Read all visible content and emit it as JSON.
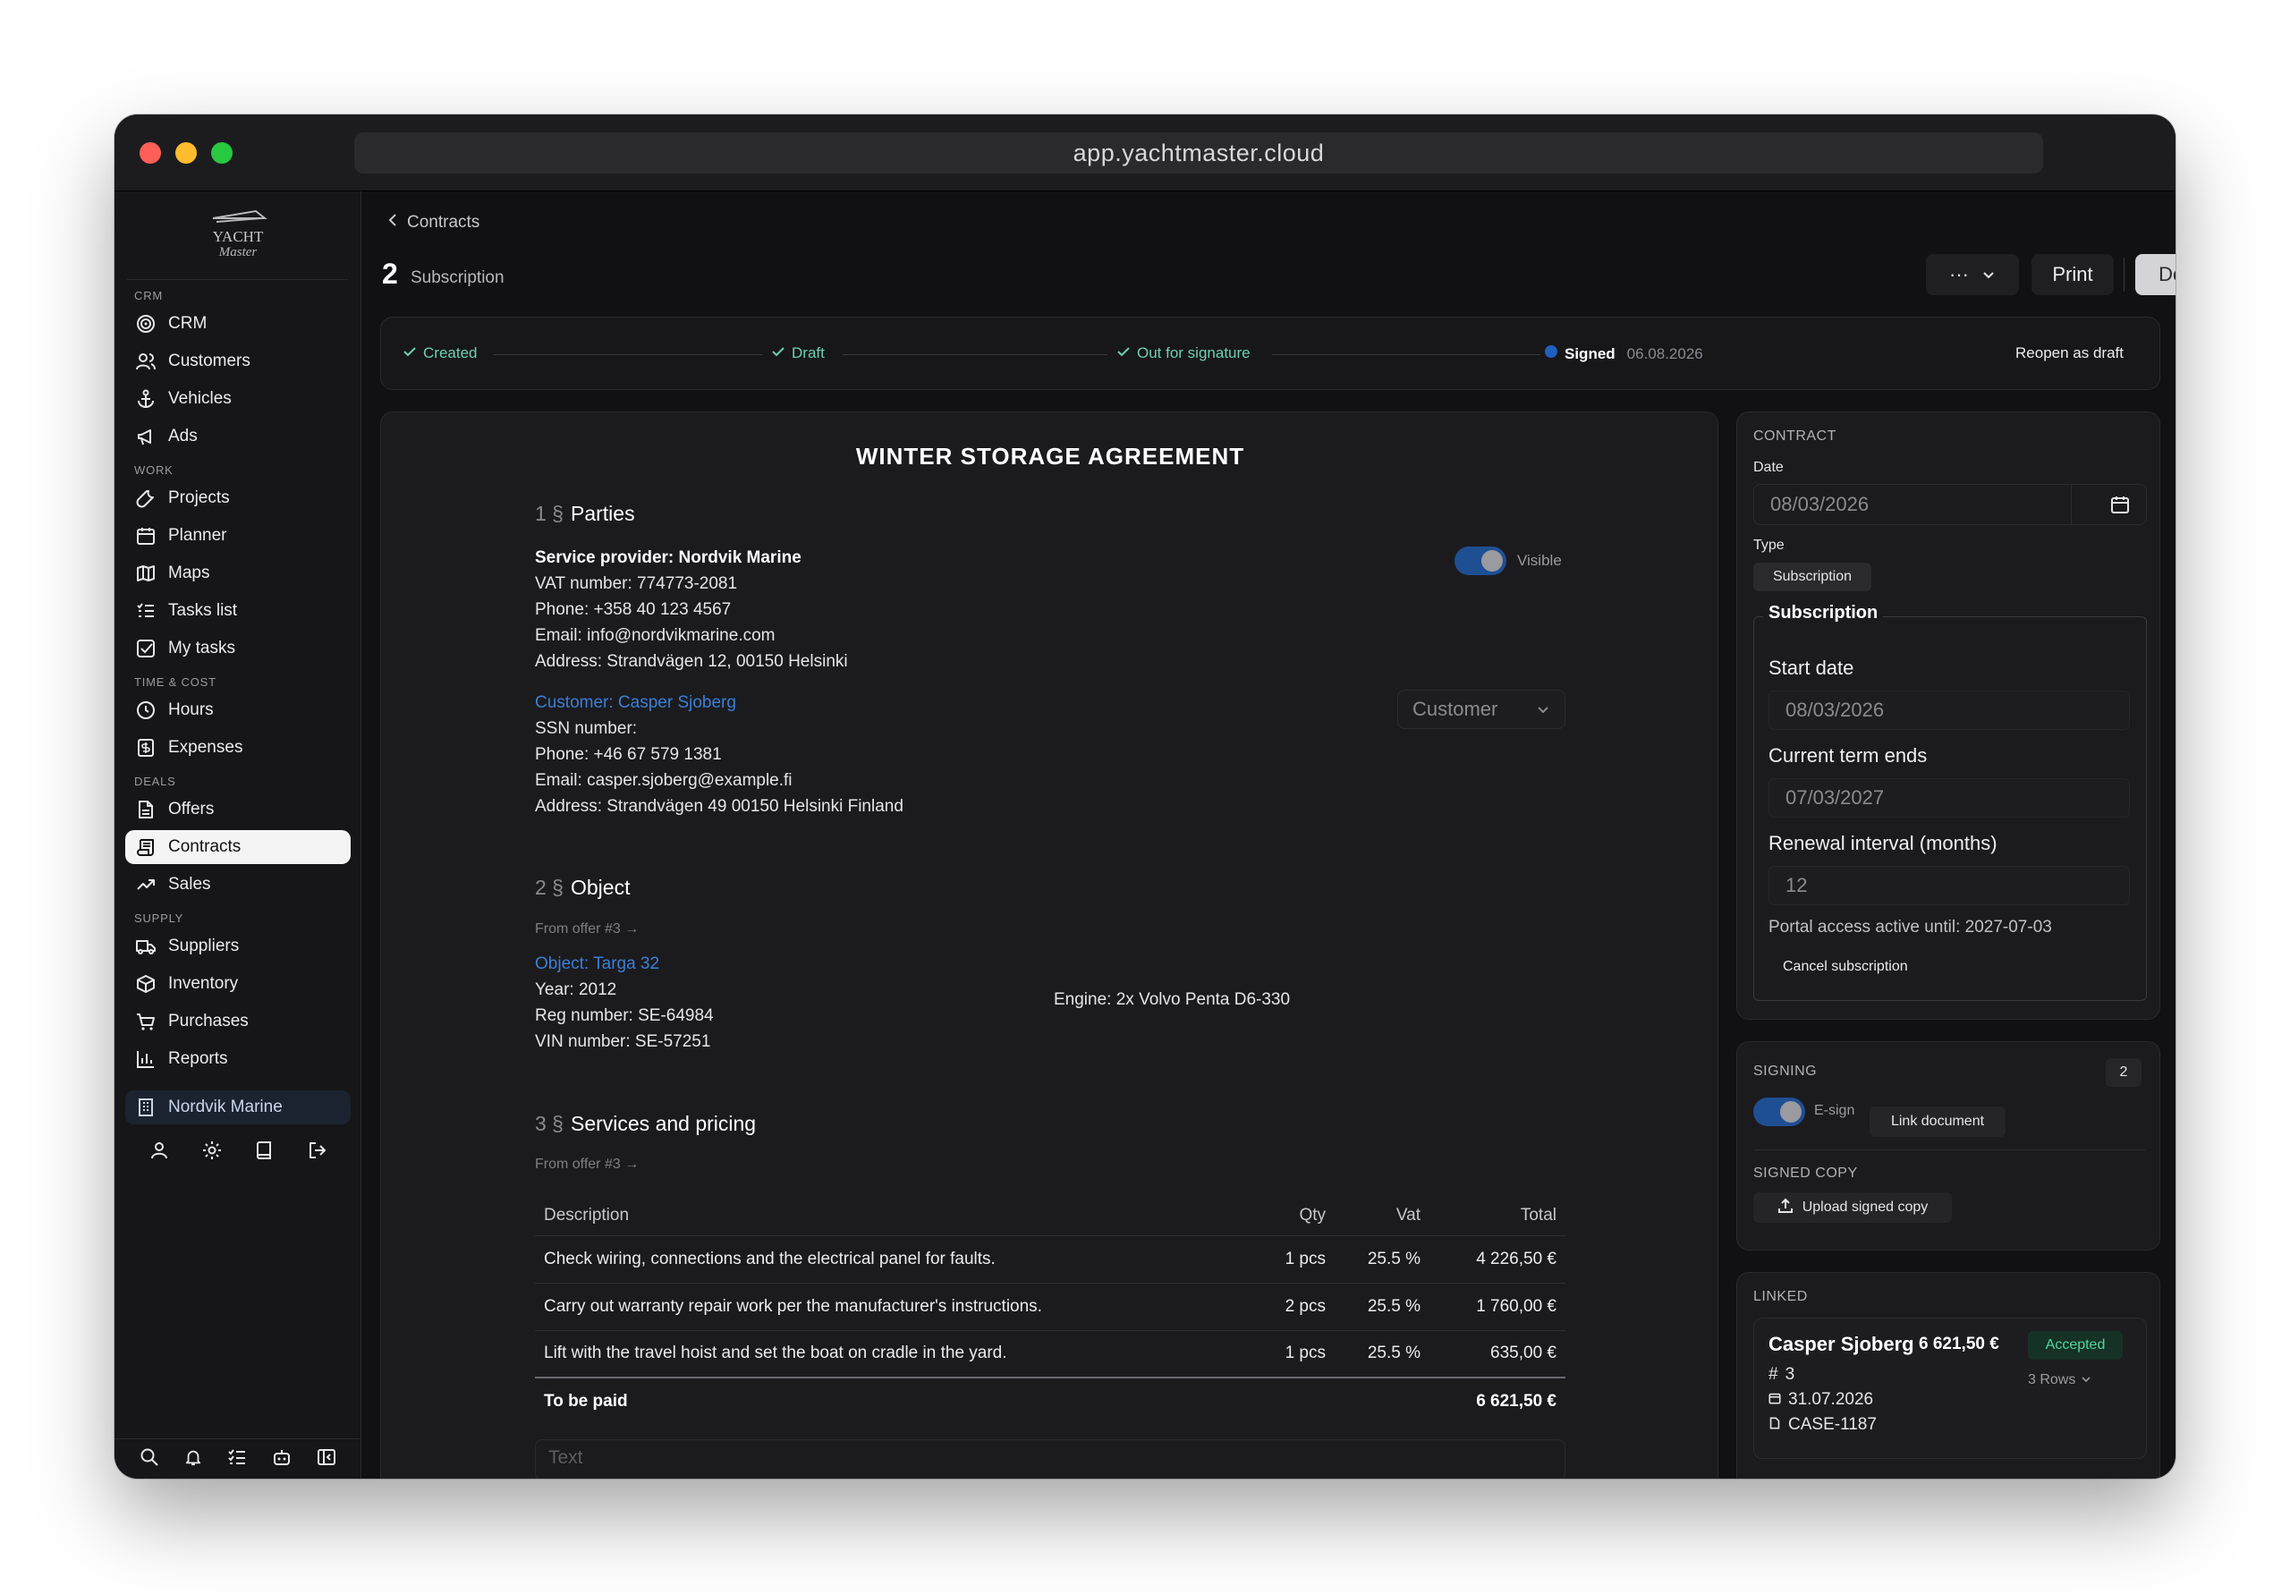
{
  "browser": {
    "url": "app.yachtmaster.cloud"
  },
  "logo": {
    "line1": "YACHT",
    "line2": "Master"
  },
  "sidebar": {
    "sections": [
      {
        "label": "CRM",
        "items": [
          {
            "label": "CRM",
            "icon": "target-icon"
          },
          {
            "label": "Customers",
            "icon": "users-icon"
          },
          {
            "label": "Vehicles",
            "icon": "anchor-icon"
          },
          {
            "label": "Ads",
            "icon": "megaphone-icon"
          }
        ]
      },
      {
        "label": "WORK",
        "items": [
          {
            "label": "Projects",
            "icon": "wrench-icon"
          },
          {
            "label": "Planner",
            "icon": "calendar-icon"
          },
          {
            "label": "Maps",
            "icon": "map-icon"
          },
          {
            "label": "Tasks list",
            "icon": "list-icon"
          },
          {
            "label": "My tasks",
            "icon": "checkbox-icon"
          }
        ]
      },
      {
        "label": "TIME & COST",
        "items": [
          {
            "label": "Hours",
            "icon": "clock-icon"
          },
          {
            "label": "Expenses",
            "icon": "receipt-icon"
          }
        ]
      },
      {
        "label": "DEALS",
        "items": [
          {
            "label": "Offers",
            "icon": "document-icon"
          },
          {
            "label": "Contracts",
            "icon": "scroll-icon",
            "active": true
          },
          {
            "label": "Sales",
            "icon": "trend-icon"
          }
        ]
      },
      {
        "label": "SUPPLY",
        "items": [
          {
            "label": "Suppliers",
            "icon": "truck-icon"
          },
          {
            "label": "Inventory",
            "icon": "box-icon"
          },
          {
            "label": "Purchases",
            "icon": "cart-icon"
          },
          {
            "label": "Reports",
            "icon": "bar-chart-icon"
          }
        ]
      }
    ],
    "company": "Nordvik Marine"
  },
  "header": {
    "breadcrumb": "Contracts",
    "number": "2",
    "type": "Subscription",
    "more_label": "···",
    "print_label": "Print",
    "download_label": "Download"
  },
  "progress": {
    "steps": [
      {
        "label": "Created",
        "state": "done"
      },
      {
        "label": "Draft",
        "state": "done"
      },
      {
        "label": "Out for signature",
        "state": "done"
      },
      {
        "label": "Signed",
        "state": "current",
        "date": "06.08.2026"
      }
    ],
    "reopen_label": "Reopen as draft"
  },
  "document": {
    "title": "WINTER STORAGE AGREEMENT",
    "parties": {
      "num": "1 §",
      "heading": "Parties",
      "provider": {
        "name_line": "Service provider: Nordvik Marine",
        "vat": "VAT number: 774773-2081",
        "phone": "Phone: +358 40 123 4567",
        "email": "Email: info@nordvikmarine.com",
        "address": "Address: Strandvägen 12, 00150 Helsinki"
      },
      "visible_label": "Visible",
      "customer": {
        "link": "Customer: Casper Sjoberg",
        "ssn": "SSN number:",
        "phone": "Phone: +46 67 579 1381",
        "email": "Email: casper.sjoberg@example.fi",
        "address": "Address: Strandvägen 49 00150 Helsinki Finland"
      },
      "customer_select": "Customer"
    },
    "object": {
      "num": "2 §",
      "heading": "Object",
      "from_offer": "From offer #3 →",
      "link": "Object: Targa 32",
      "year": "Year: 2012",
      "reg": "Reg number: SE-64984",
      "vin": "VIN number: SE-57251",
      "engine": "Engine: 2x Volvo Penta D6-330"
    },
    "services": {
      "num": "3 §",
      "heading": "Services and pricing",
      "from_offer": "From offer #3 →",
      "columns": [
        "Description",
        "Qty",
        "Vat",
        "Total"
      ],
      "rows": [
        [
          "Check wiring, connections and the electrical panel for faults.",
          "1 pcs",
          "25.5 %",
          "4 226,50 €"
        ],
        [
          "Carry out warranty repair work per the manufacturer's instructions.",
          "2 pcs",
          "25.5 %",
          "1 760,00 €"
        ],
        [
          "Lift with the travel hoist and set the boat on cradle in the yard.",
          "1 pcs",
          "25.5 %",
          "635,00 €"
        ]
      ],
      "total_label": "To be paid",
      "total_value": "6 621,50 €",
      "text_placeholder": "Text"
    }
  },
  "contract_panel": {
    "heading": "CONTRACT",
    "date_label": "Date",
    "date_value": "08/03/2026",
    "type_label": "Type",
    "type_value": "Subscription",
    "subscription": {
      "legend": "Subscription",
      "start_label": "Start date",
      "start_value": "08/03/2026",
      "term_label": "Current term ends",
      "term_value": "07/03/2027",
      "renewal_label": "Renewal interval (months)",
      "renewal_value": "12",
      "portal": "Portal access active until: 2027-07-03",
      "cancel": "Cancel subscription"
    }
  },
  "signing_panel": {
    "heading": "SIGNING",
    "count": "2",
    "esign_label": "E-sign",
    "link_document": "Link document",
    "signed_copy_heading": "SIGNED COPY",
    "upload_label": "Upload signed copy"
  },
  "linked_panel": {
    "heading": "LINKED",
    "card": {
      "name": "Casper Sjoberg",
      "amount": "6 621,50 €",
      "status": "Accepted",
      "number": "3",
      "rows": "3 Rows",
      "date": "31.07.2026",
      "case": "CASE-1187"
    }
  },
  "colors": {
    "accent_blue": "#3b7fd8",
    "done_green": "#6fcfae",
    "accepted_green": "#4fd69c"
  }
}
